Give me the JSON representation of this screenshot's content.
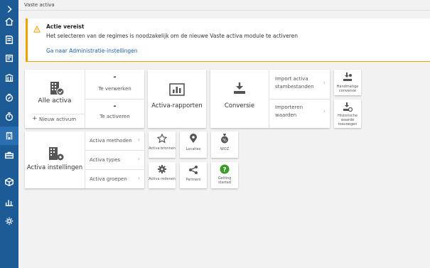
{
  "breadcrumb": "Vaste activa",
  "alert": {
    "title": "Actie vereist",
    "message": "Het selecteren van de regimes is noodzakelijk om de nieuwe Vaste activa module te activeren",
    "link": "Ga naar Administratie-instellingen",
    "color": "#f0a000"
  },
  "colors": {
    "rail": "#1c5b96",
    "link": "#1a5fa8",
    "help": "#3a9a2a"
  },
  "rail_icons": [
    "chevron-right-icon",
    "home-icon",
    "document-icon",
    "invoice-icon",
    "bank-icon",
    "percent-icon",
    "stopwatch-icon",
    "building-icon",
    "toolbox-icon",
    "cube-icon",
    "chart-icon",
    "gear-icon"
  ],
  "assets": {
    "title": "Alle activa",
    "new_label": "Nieuw activum",
    "to_process_value": "-",
    "to_process_label": "Te verwerken",
    "to_activate_value": "-",
    "to_activate_label": "Te activeren"
  },
  "reports": {
    "title": "Activa-rapporten"
  },
  "conversion": {
    "title": "Conversie",
    "import_base": "Import activa stambestanden",
    "import_values": "Importeren waarden",
    "manual": "Handmatige conversie",
    "history": "Historische waarde toevoegen"
  },
  "settings": {
    "title": "Activa instellingen",
    "items": [
      "Activa methoden",
      "Activa types",
      "Activa groepen"
    ]
  },
  "tiles": {
    "sources": "Activa bronnen",
    "locations": "Locaties",
    "woz": "WOZ",
    "reasons": "Activa redenen",
    "partners": "Partners",
    "getting_started": "Getting started"
  }
}
